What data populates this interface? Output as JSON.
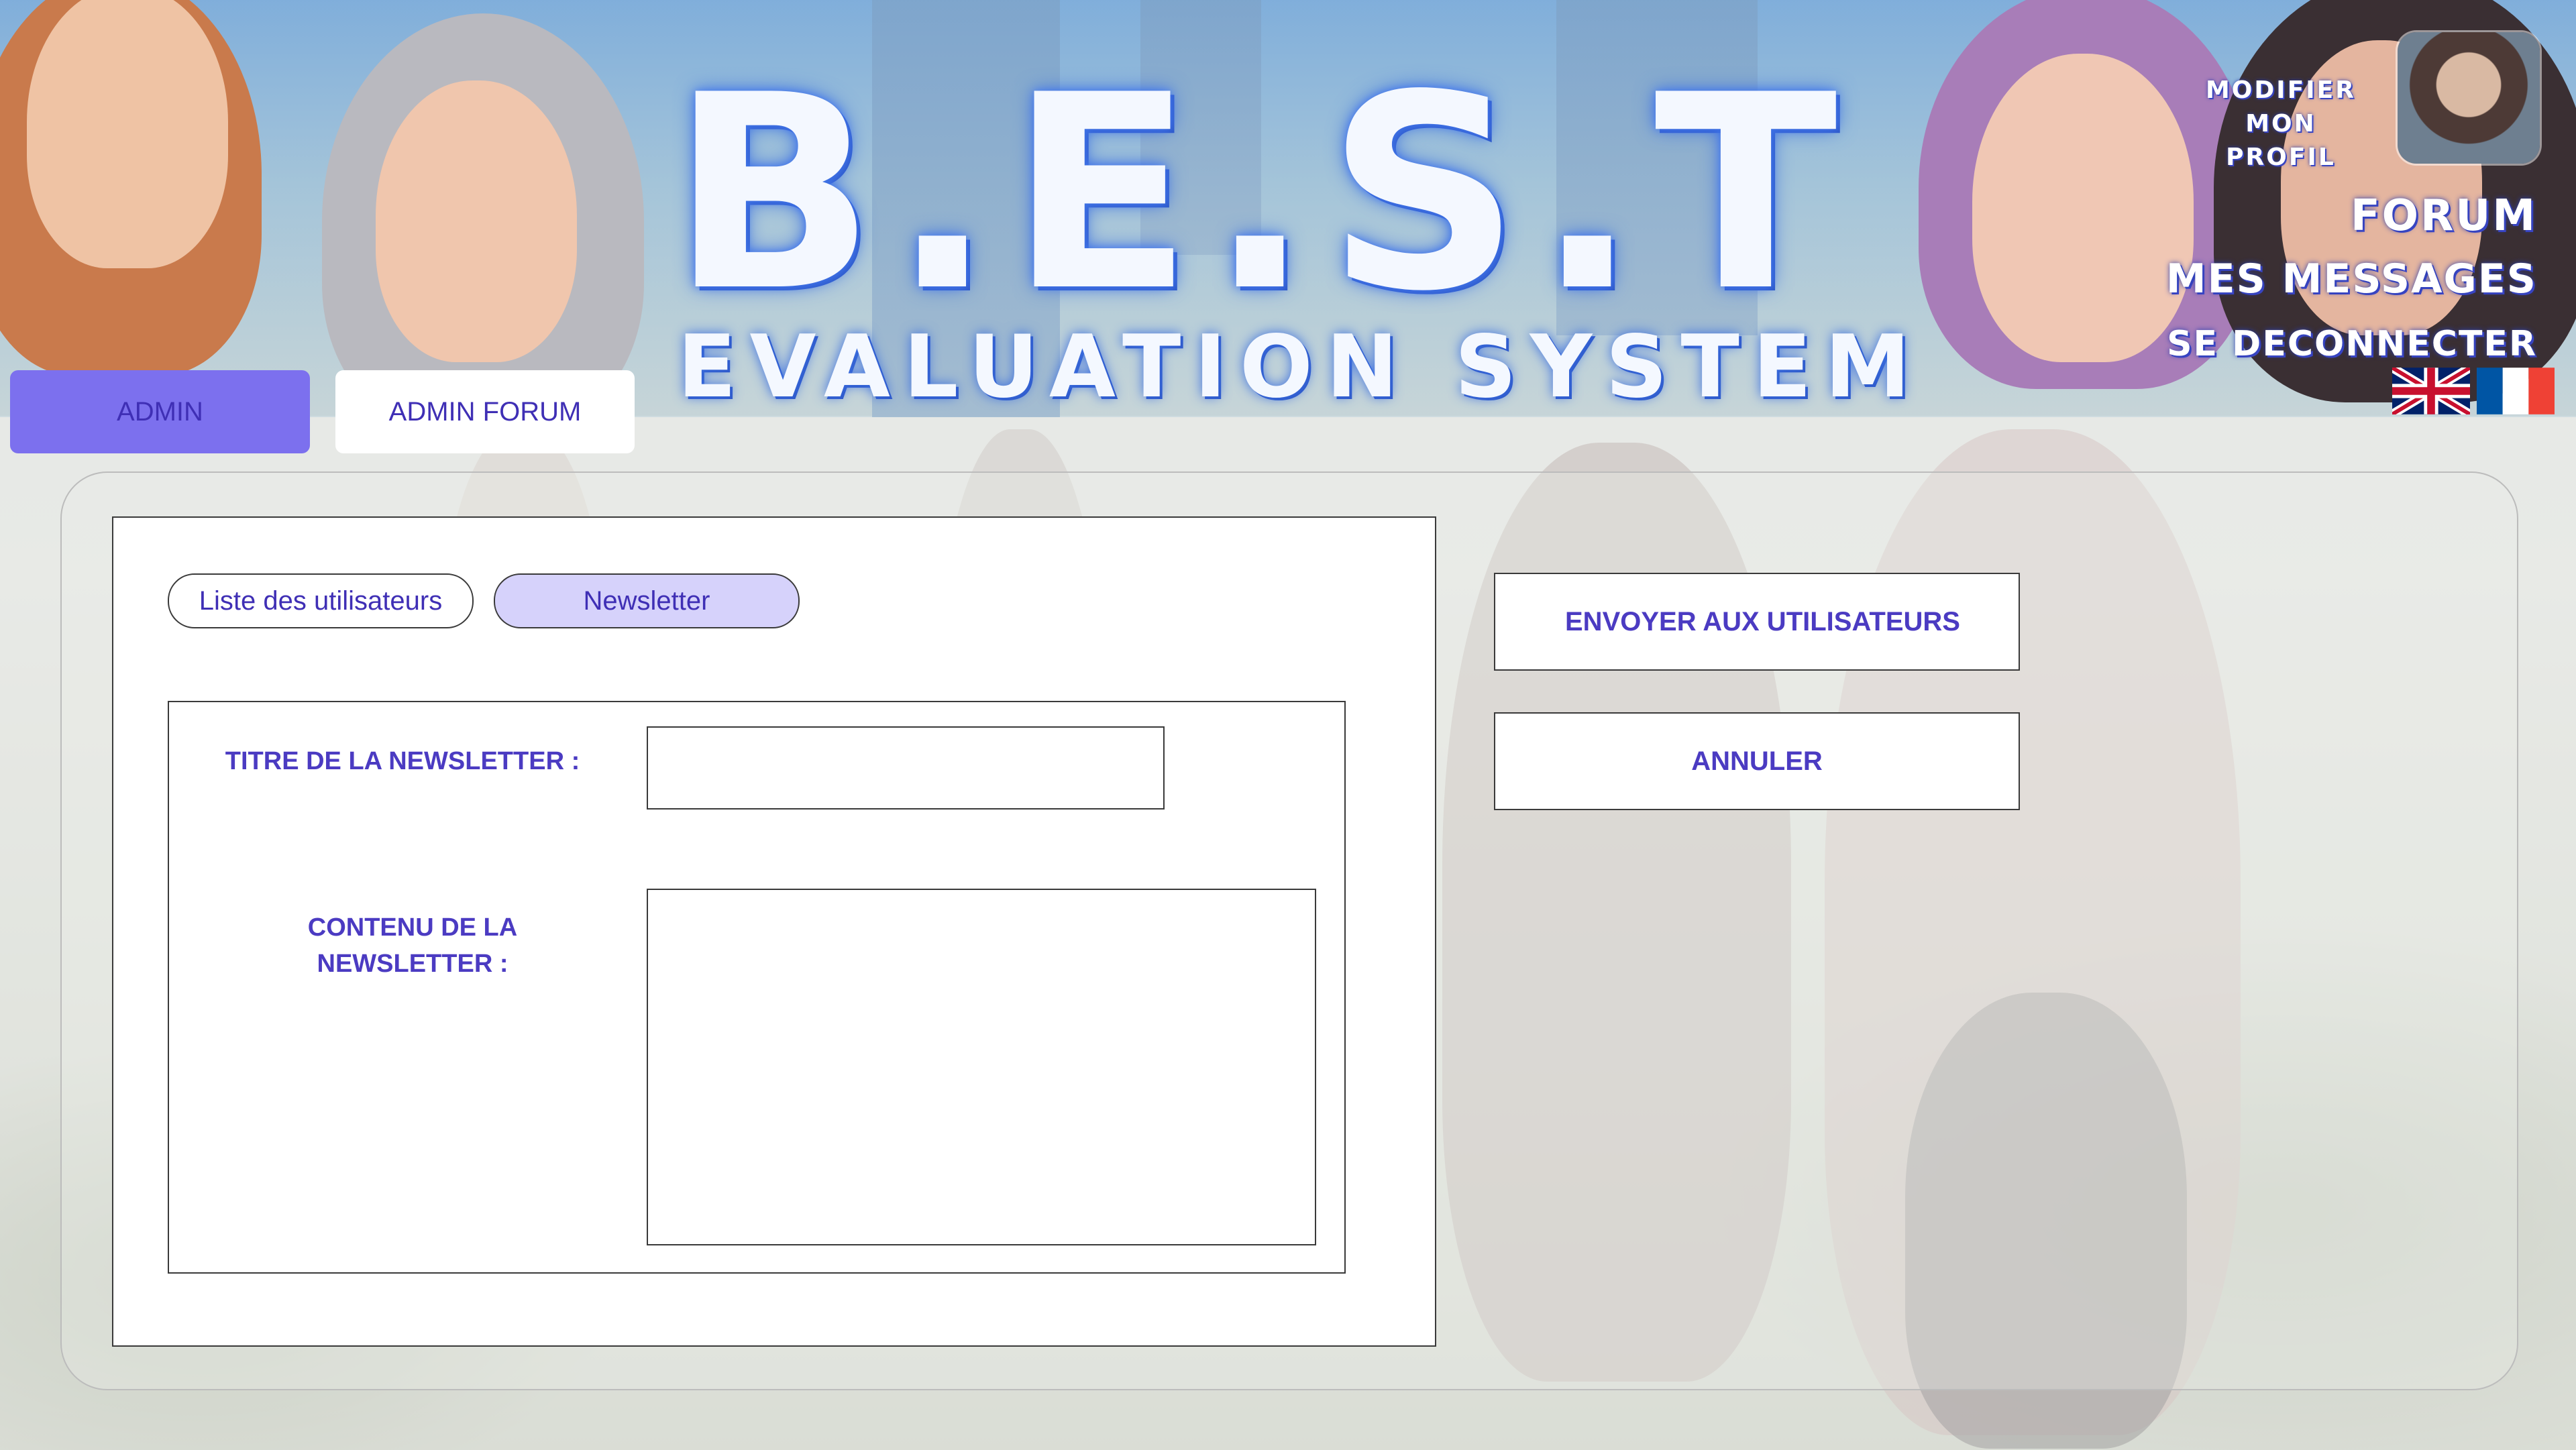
{
  "header": {
    "logo_title": "B.E.S.T",
    "logo_subtitle": "EVALUATION SYSTEM",
    "profile_link": "MODIFIER MON PROFIL",
    "nav": {
      "forum": "FORUM",
      "messages": "MES MESSAGES",
      "logout": "SE DECONNECTER"
    },
    "languages": [
      "en",
      "fr"
    ]
  },
  "tabs": {
    "admin": "ADMIN",
    "admin_forum": "ADMIN FORUM",
    "active": "admin"
  },
  "subtabs": {
    "users": "Liste des utilisateurs",
    "newsletter": "Newsletter",
    "active": "newsletter"
  },
  "form": {
    "title_label": "TITRE DE LA NEWSLETTER :",
    "title_value": "",
    "content_label": "CONTENU DE LA NEWSLETTER :",
    "content_value": ""
  },
  "actions": {
    "send": "ENVOYER AUX UTILISATEURS",
    "cancel": "ANNULER"
  },
  "colors": {
    "accent": "#7c70ee",
    "accent_light": "#d6d2fb",
    "text": "#4b3bc2",
    "logo_glow": "#3b6fe0"
  }
}
